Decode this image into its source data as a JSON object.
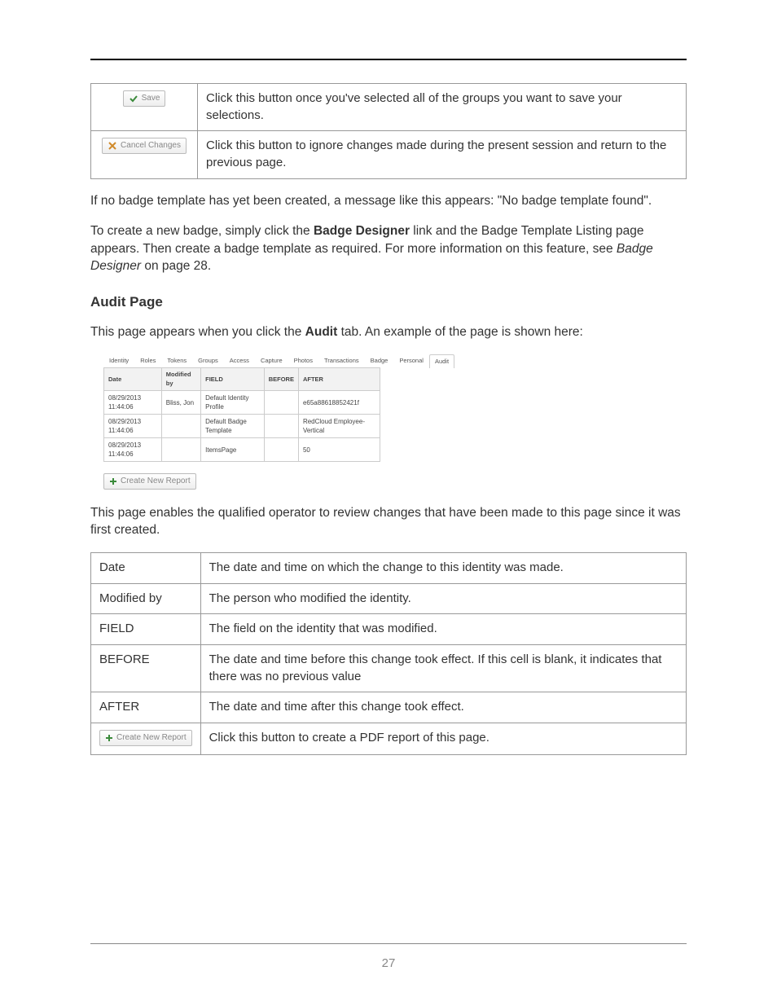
{
  "buttons_table": [
    {
      "icon": "check",
      "label": "Save",
      "desc": "Click this button once you've selected all of the groups you want to save your selections."
    },
    {
      "icon": "cancel",
      "label": "Cancel Changes",
      "desc": "Click this button to ignore changes made during the present session and return to the previous page."
    }
  ],
  "para_no_template": "If no badge template has yet been created, a message like this appears: \"No badge template found\".",
  "para_create_pre": "To create a new badge, simply click the ",
  "para_create_bold": "Badge Designer",
  "para_create_mid": " link and the Badge Template Listing page appears. Then create a badge template as required. For more information on this feature, see ",
  "para_create_italic": "Badge Designer",
  "para_create_post": " on page 28.",
  "heading_audit": "Audit Page",
  "para_audit_intro_pre": "This page appears when you click the ",
  "para_audit_intro_bold": "Audit",
  "para_audit_intro_post": " tab. An example of the page is shown here:",
  "mock": {
    "tabs": [
      "Identity",
      "Roles",
      "Tokens",
      "Groups",
      "Access",
      "Capture",
      "Photos",
      "Transactions",
      "Badge",
      "Personal",
      "Audit"
    ],
    "active_tab": 10,
    "headers": [
      "Date",
      "Modified by",
      "FIELD",
      "BEFORE",
      "AFTER"
    ],
    "rows": [
      [
        "08/29/2013 11:44:06",
        "Bliss, Jon",
        "Default Identity Profile",
        "",
        "e65a88618852421f"
      ],
      [
        "08/29/2013 11:44:06",
        "",
        "Default Badge Template",
        "",
        "RedCloud Employee-Vertical"
      ],
      [
        "08/29/2013 11:44:06",
        "",
        "ItemsPage",
        "",
        "50"
      ]
    ],
    "button_label": "Create New Report"
  },
  "para_audit_desc": "This page enables the qualified operator to review changes that have been made to this page since it was first created.",
  "def_table": [
    {
      "key": "Date",
      "desc": "The date and time on which the change to this identity was made."
    },
    {
      "key": "Modified by",
      "desc": "The person who modified the identity."
    },
    {
      "key": "FIELD",
      "desc": "The field on the identity that was modified."
    },
    {
      "key": "BEFORE",
      "desc": "The date and time before this change took effect. If this cell is blank, it indicates that there was no previous value"
    },
    {
      "key": "AFTER",
      "desc": "The date and time after this change took effect."
    }
  ],
  "def_table_last": {
    "button_label": "Create New Report",
    "desc": "Click this button to create a PDF report of this page."
  },
  "page_number": "27"
}
